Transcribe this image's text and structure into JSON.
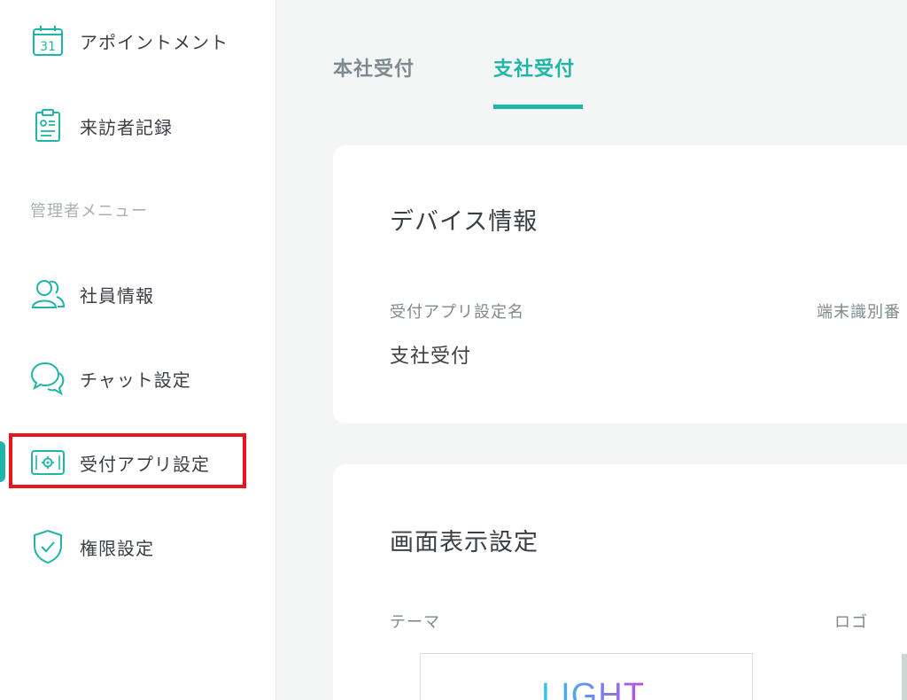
{
  "sidebar": {
    "items_top": [
      {
        "label": "アポイントメント",
        "icon": "calendar-31-icon"
      },
      {
        "label": "来訪者記録",
        "icon": "clipboard-record-icon"
      }
    ],
    "section_title": "管理者メニュー",
    "items_admin": [
      {
        "label": "社員情報",
        "icon": "users-icon"
      },
      {
        "label": "チャット設定",
        "icon": "chat-bubbles-icon"
      },
      {
        "label": "受付アプリ設定",
        "icon": "tablet-gear-icon",
        "active": true
      },
      {
        "label": "権限設定",
        "icon": "shield-check-icon"
      }
    ],
    "calendar_day": "31"
  },
  "tabs": [
    {
      "label": "本社受付",
      "active": false
    },
    {
      "label": "支社受付",
      "active": true
    }
  ],
  "device_card": {
    "title": "デバイス情報",
    "fields": [
      {
        "label": "受付アプリ設定名",
        "value": "支社受付"
      },
      {
        "label": "端末識別番",
        "value": ""
      }
    ]
  },
  "display_card": {
    "title": "画面表示設定",
    "theme_label": "テーマ",
    "logo_label": "ロゴ",
    "theme_preview_text": "LIGHT"
  },
  "colors": {
    "accent": "#1fb5a8",
    "highlight": "#e8151d",
    "text": "#3a3f45",
    "muted": "#7f8a90"
  }
}
